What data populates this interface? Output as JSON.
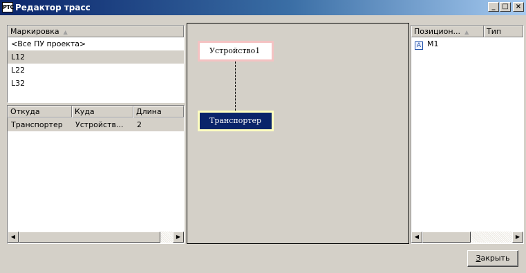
{
  "window": {
    "icon_text": "РТС",
    "title": "Редактор трасс",
    "btn_min": "_",
    "btn_max": "□",
    "btn_close": "×"
  },
  "marking_list": {
    "header": "Маркировка",
    "sort_indicator": "▲",
    "items": [
      "<Все ПУ проекта>",
      "L12",
      "L22",
      "L32"
    ],
    "selected_index": 1
  },
  "routes_table": {
    "headers": [
      "Откуда",
      "Куда",
      "Длина"
    ],
    "rows": [
      [
        "Транспортер",
        "Устройств...",
        "2"
      ]
    ]
  },
  "canvas": {
    "node_device_label": "Устройство1",
    "node_transporter_label": "Транспортер"
  },
  "positions_list": {
    "headers": [
      "Позицион...",
      "Тип"
    ],
    "sort_indicator": "▲",
    "items": [
      {
        "badge": "A",
        "label": "M1"
      }
    ]
  },
  "scroll": {
    "left_arrow": "◀",
    "right_arrow": "▶"
  },
  "footer": {
    "close_label_first": "З",
    "close_label_rest": "акрыть"
  }
}
